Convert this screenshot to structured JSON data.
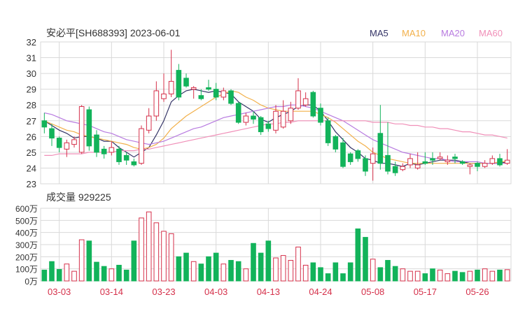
{
  "header": {
    "title": "安必平[SH688393] 2023-06-01",
    "legend": [
      {
        "label": "MA5",
        "color": "#333366"
      },
      {
        "label": "MA10",
        "color": "#f2b04a"
      },
      {
        "label": "MA20",
        "color": "#b87be0"
      },
      {
        "label": "MA60",
        "color": "#f08fb8"
      }
    ]
  },
  "volume_title": "成交量 929225",
  "colors": {
    "up": "#d5304a",
    "down": "#12b35a",
    "grid": "#d9d9d9",
    "axis_text": "#333333",
    "date_text": "#d5304a"
  },
  "chart_data": [
    {
      "type": "candlestick",
      "dates": [
        "03-01",
        "03-02",
        "03-03",
        "03-06",
        "03-07",
        "03-08",
        "03-09",
        "03-10",
        "03-13",
        "03-14",
        "03-15",
        "03-16",
        "03-17",
        "03-20",
        "03-21",
        "03-22",
        "03-23",
        "03-24",
        "03-27",
        "03-28",
        "03-29",
        "03-30",
        "03-31",
        "04-03",
        "04-04",
        "04-06",
        "04-07",
        "04-10",
        "04-11",
        "04-12",
        "04-13",
        "04-14",
        "04-17",
        "04-18",
        "04-19",
        "04-20",
        "04-21",
        "04-24",
        "04-25",
        "04-26",
        "04-27",
        "04-28",
        "05-04",
        "05-05",
        "05-08",
        "05-09",
        "05-10",
        "05-11",
        "05-12",
        "05-15",
        "05-16",
        "05-17",
        "05-18",
        "05-19",
        "05-22",
        "05-23",
        "05-24",
        "05-25",
        "05-26",
        "05-29",
        "05-30",
        "05-31",
        "06-01"
      ],
      "open": [
        27.0,
        26.5,
        25.9,
        25.2,
        25.5,
        25.0,
        27.7,
        26.1,
        25.2,
        25.0,
        25.2,
        24.8,
        24.4,
        24.3,
        26.4,
        27.3,
        28.4,
        28.7,
        30.2,
        29.7,
        29.0,
        28.6,
        29.1,
        29.0,
        28.5,
        28.9,
        28.1,
        26.9,
        27.3,
        27.2,
        26.8,
        26.4,
        26.6,
        27.0,
        27.8,
        28.0,
        28.8,
        27.8,
        27.0,
        26.0,
        25.6,
        24.9,
        25.1,
        24.6,
        24.3,
        26.2,
        24.8,
        24.1,
        23.9,
        24.2,
        24.0,
        24.4,
        24.6,
        24.6,
        24.4,
        24.7,
        24.4,
        24.1,
        24.3,
        24.1,
        24.3,
        24.6,
        24.3
      ],
      "close": [
        26.6,
        25.9,
        25.3,
        25.6,
        25.8,
        27.9,
        25.4,
        25.0,
        24.9,
        25.3,
        24.4,
        24.5,
        24.2,
        26.5,
        27.3,
        28.9,
        28.7,
        29.5,
        28.5,
        29.2,
        29.1,
        28.4,
        29.0,
        28.5,
        28.9,
        28.1,
        26.9,
        27.3,
        27.1,
        26.3,
        26.5,
        27.6,
        27.6,
        27.8,
        28.9,
        28.4,
        27.3,
        26.9,
        25.6,
        25.2,
        24.1,
        24.4,
        24.6,
        23.8,
        24.9,
        24.3,
        23.8,
        23.7,
        24.1,
        24.6,
        24.2,
        24.3,
        24.5,
        24.7,
        24.5,
        24.6,
        24.3,
        24.2,
        24.1,
        24.3,
        24.6,
        24.2,
        24.5
      ],
      "high": [
        27.5,
        26.8,
        26.0,
        25.8,
        26.0,
        28.0,
        27.9,
        26.4,
        25.4,
        25.7,
        25.4,
        25.0,
        24.6,
        26.7,
        27.8,
        29.5,
        30.0,
        31.5,
        30.6,
        30.0,
        29.2,
        29.0,
        29.6,
        29.4,
        29.1,
        29.0,
        28.2,
        27.5,
        27.6,
        27.3,
        27.0,
        28.0,
        28.3,
        28.2,
        29.7,
        28.8,
        28.9,
        28.1,
        27.2,
        26.1,
        25.9,
        25.0,
        25.2,
        24.8,
        25.3,
        28.0,
        26.9,
        24.4,
        24.3,
        24.9,
        25.0,
        25.0,
        25.0,
        25.0,
        24.8,
        24.9,
        24.5,
        24.3,
        24.4,
        24.5,
        24.8,
        24.9,
        25.2
      ],
      "low": [
        26.2,
        25.4,
        25.0,
        24.7,
        25.3,
        24.9,
        25.1,
        24.7,
        24.6,
        24.8,
        24.2,
        24.2,
        24.1,
        24.2,
        26.2,
        27.0,
        28.2,
        28.5,
        28.3,
        29.1,
        28.4,
        28.3,
        28.9,
        28.3,
        28.3,
        28.0,
        26.8,
        26.7,
        26.8,
        26.1,
        26.3,
        26.2,
        26.5,
        26.8,
        27.7,
        27.9,
        27.2,
        26.7,
        25.4,
        25.0,
        24.0,
        24.2,
        24.4,
        23.5,
        23.2,
        23.9,
        23.6,
        23.5,
        23.8,
        24.0,
        23.9,
        24.2,
        24.2,
        24.5,
        24.2,
        24.3,
        24.2,
        23.6,
        23.8,
        24.0,
        24.2,
        24.1,
        24.2
      ],
      "ylim": [
        23,
        32
      ],
      "yticks": [
        23,
        24,
        25,
        26,
        27,
        28,
        29,
        30,
        31,
        32
      ],
      "xticks": [
        "03-03",
        "03-14",
        "03-23",
        "04-03",
        "04-13",
        "04-24",
        "05-08",
        "05-17",
        "05-26"
      ],
      "series": [
        {
          "name": "MA5",
          "values": [
            27.0,
            26.7,
            26.4,
            26.2,
            25.9,
            26.0,
            26.0,
            25.9,
            25.7,
            25.7,
            25.3,
            25.0,
            24.7,
            25.0,
            25.3,
            26.1,
            27.0,
            28.2,
            28.6,
            28.9,
            29.0,
            28.9,
            28.8,
            28.9,
            28.8,
            28.7,
            28.2,
            27.9,
            27.6,
            27.1,
            26.9,
            27.2,
            27.4,
            27.6,
            27.9,
            28.0,
            28.0,
            27.6,
            27.0,
            26.3,
            25.8,
            25.3,
            25.0,
            24.6,
            24.5,
            24.3,
            24.3,
            24.2,
            24.1,
            24.3,
            24.2,
            24.3,
            24.4,
            24.5,
            24.5,
            24.5,
            24.4,
            24.3,
            24.3,
            24.3,
            24.3,
            24.3,
            24.4
          ]
        },
        {
          "name": "MA10",
          "values": [
            27.0,
            26.8,
            26.6,
            26.4,
            26.3,
            26.1,
            26.0,
            25.9,
            25.8,
            25.7,
            25.6,
            25.5,
            25.3,
            25.2,
            25.3,
            25.5,
            25.9,
            26.5,
            26.9,
            27.3,
            27.6,
            27.9,
            28.2,
            28.5,
            28.7,
            28.9,
            28.8,
            28.5,
            28.3,
            28.0,
            27.8,
            27.7,
            27.6,
            27.6,
            27.6,
            27.6,
            27.6,
            27.4,
            27.2,
            26.9,
            26.5,
            26.1,
            25.7,
            25.4,
            25.0,
            24.8,
            24.6,
            24.5,
            24.4,
            24.3,
            24.3,
            24.3,
            24.3,
            24.3,
            24.3,
            24.3,
            24.3,
            24.3,
            24.3,
            24.3,
            24.3,
            24.4,
            24.4
          ]
        },
        {
          "name": "MA20",
          "values": [
            27.5,
            27.4,
            27.2,
            27.0,
            26.9,
            26.8,
            26.7,
            26.5,
            26.3,
            26.2,
            26.0,
            25.8,
            25.7,
            25.6,
            25.5,
            25.6,
            25.7,
            25.9,
            26.1,
            26.3,
            26.5,
            26.6,
            26.8,
            27.0,
            27.2,
            27.3,
            27.4,
            27.5,
            27.6,
            27.7,
            27.8,
            27.9,
            27.9,
            28.0,
            28.0,
            27.9,
            27.8,
            27.6,
            27.4,
            27.2,
            27.0,
            26.7,
            26.4,
            26.1,
            25.8,
            25.6,
            25.4,
            25.2,
            25.0,
            24.9,
            24.8,
            24.7,
            24.6,
            24.6,
            24.5,
            24.4,
            24.4,
            24.4,
            24.4,
            24.3,
            24.3,
            24.3,
            24.3
          ]
        },
        {
          "name": "MA60",
          "values": [
            24.8,
            24.8,
            24.9,
            24.9,
            24.9,
            24.9,
            25.0,
            25.0,
            25.0,
            25.0,
            25.1,
            25.1,
            25.1,
            25.2,
            25.2,
            25.3,
            25.4,
            25.5,
            25.6,
            25.7,
            25.8,
            25.9,
            26.0,
            26.1,
            26.2,
            26.3,
            26.4,
            26.5,
            26.6,
            26.7,
            26.8,
            26.8,
            26.9,
            26.9,
            27.0,
            27.0,
            27.0,
            27.0,
            27.0,
            27.0,
            27.0,
            27.0,
            27.0,
            27.0,
            26.9,
            26.9,
            26.9,
            26.8,
            26.8,
            26.7,
            26.7,
            26.6,
            26.6,
            26.5,
            26.5,
            26.4,
            26.3,
            26.3,
            26.2,
            26.1,
            26.1,
            26.0,
            25.9
          ]
        }
      ]
    },
    {
      "type": "bar",
      "name": "成交量",
      "unit": "万",
      "values": [
        90,
        160,
        95,
        140,
        80,
        340,
        330,
        155,
        120,
        100,
        130,
        90,
        330,
        520,
        570,
        480,
        410,
        390,
        200,
        230,
        160,
        140,
        200,
        230,
        140,
        170,
        160,
        100,
        310,
        230,
        330,
        190,
        210,
        170,
        280,
        130,
        150,
        110,
        60,
        150,
        60,
        150,
        430,
        360,
        180,
        110,
        170,
        120,
        100,
        80,
        80,
        60,
        100,
        90,
        60,
        80,
        70,
        80,
        90,
        100,
        80,
        90,
        93
      ],
      "ylim": [
        0,
        600
      ],
      "yticks": [
        "0万",
        "100万",
        "200万",
        "300万",
        "400万",
        "500万",
        "600万"
      ]
    }
  ]
}
